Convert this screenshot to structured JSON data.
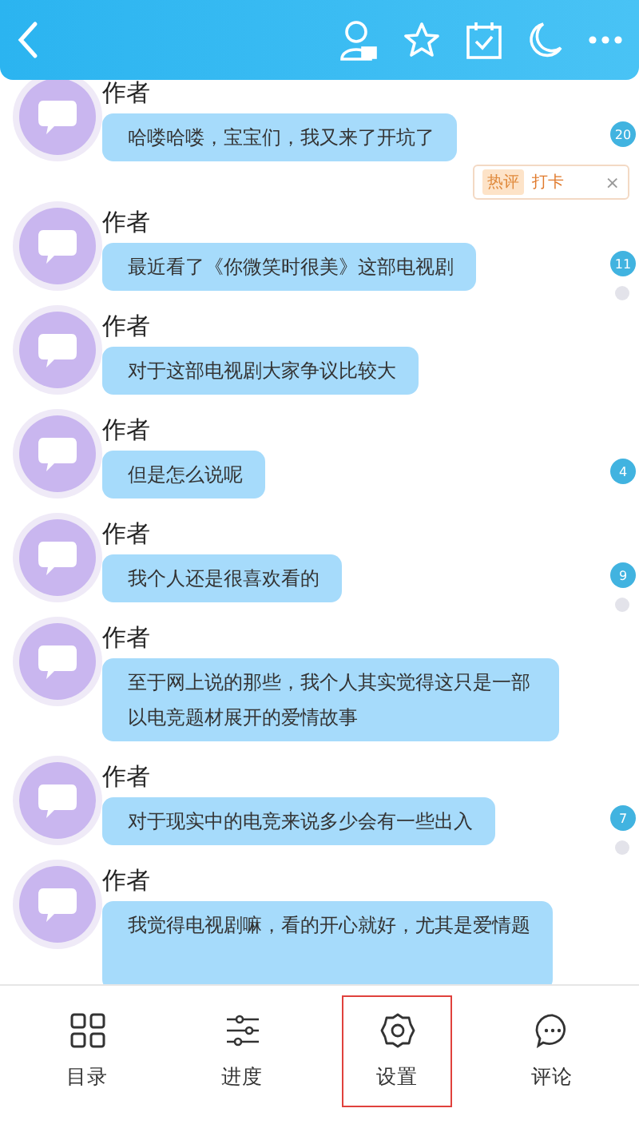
{
  "messages": [
    {
      "author": "作者",
      "text": "哈喽哈喽，宝宝们，我又来了开坑了",
      "badge": "20",
      "dot": false
    },
    {
      "author": "作者",
      "text": "最近看了《你微笑时很美》这部电视剧",
      "badge": "11",
      "dot": true
    },
    {
      "author": "作者",
      "text": "对于这部电视剧大家争议比较大",
      "dot": false
    },
    {
      "author": "作者",
      "text": "但是怎么说呢",
      "badge": "4",
      "dot": false
    },
    {
      "author": "作者",
      "text": "我个人还是很喜欢看的",
      "badge": "9",
      "dot": true
    },
    {
      "author": "作者",
      "text": "至于网上说的那些，我个人其实觉得这只是一部以电竞题材展开的爱情故事",
      "dot": false
    },
    {
      "author": "作者",
      "text": "对于现实中的电竞来说多少会有一些出入",
      "badge": "7",
      "dot": true
    },
    {
      "author": "作者",
      "text": "我觉得电视剧嘛，看的开心就好，尤其是爱情题",
      "dot": false
    }
  ],
  "hot_tag": {
    "label": "热评",
    "text": "打卡",
    "close": "×"
  },
  "toolbar": [
    {
      "kind": "catalog",
      "label": "目录",
      "selected": false
    },
    {
      "kind": "progress",
      "label": "进度",
      "selected": false
    },
    {
      "kind": "settings",
      "label": "设置",
      "selected": true
    },
    {
      "kind": "comment",
      "label": "评论",
      "selected": false
    }
  ]
}
